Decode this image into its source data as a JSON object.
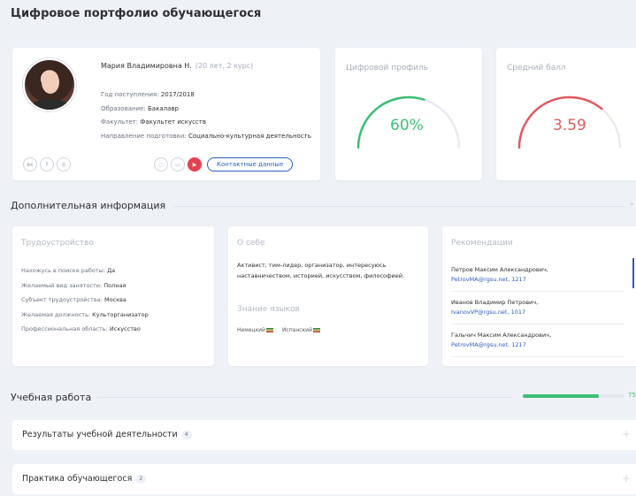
{
  "page_title": "Цифровое портфолио обучающегося",
  "profile": {
    "name": "Мария Владимировна Н.",
    "age": "(20 лет, 2 курс)",
    "fields": [
      {
        "label": "Год поступления: ",
        "value": "2017/2018"
      },
      {
        "label": "Образование: ",
        "value": "Бакалавр"
      },
      {
        "label": "Факультет: ",
        "value": "Факультет искусств"
      },
      {
        "label": "Направление подготовки: ",
        "value": "Социально-культурная деятельность"
      }
    ],
    "social": [
      "вк",
      "f",
      "◎"
    ],
    "contact_label": "Контактные данные"
  },
  "digital_profile": {
    "title": "Цифровой профиль",
    "value_text": "60%",
    "value": 0.6,
    "color": "#3bbf76"
  },
  "gpa": {
    "title": "Средний балл",
    "value_text": "3.59",
    "value": 0.72,
    "color": "#e05a5f"
  },
  "additional": {
    "title": "Дополнительная информация",
    "work": {
      "title": "Трудоустройство",
      "items": [
        {
          "label": "Нахожусь в поиске работы: ",
          "value": "Да"
        },
        {
          "label": "Желаемый вид занятости: ",
          "value": "Полная"
        },
        {
          "label": "Субъект трудоустройства: ",
          "value": "Москва"
        },
        {
          "label": "Желаемая должность: ",
          "value": "Культорганизатор"
        },
        {
          "label": "Профессиональная область: ",
          "value": "Искусство"
        }
      ]
    },
    "about": {
      "title": "О себе",
      "text": "Активист, тим-лидер, организатор, интересуюсь наставничеством, историей, искусством, философией.",
      "languages_title": "Знание языков",
      "languages": [
        "Немецкий",
        "Испанский"
      ]
    },
    "recommendations": {
      "title": "Рекомендации",
      "items": [
        {
          "name": "Петров Максим Александрович,",
          "contact": "PetrovMA@rgsu.net, 1217"
        },
        {
          "name": "Иванов Владимир Петрович,",
          "contact": "IvanovVP@rgsu.net, 1017"
        },
        {
          "name": "Гальчич Максим Александрович,",
          "contact": "PetrovMA@rgsu.net, 1217"
        }
      ]
    }
  },
  "study": {
    "title": "Учебная работа",
    "progress": 0.75,
    "progress_label": "75",
    "accordions": [
      {
        "label": "Результаты учебной деятельности",
        "count": "4"
      },
      {
        "label": "Практика обучающегося",
        "count": "2"
      }
    ]
  }
}
